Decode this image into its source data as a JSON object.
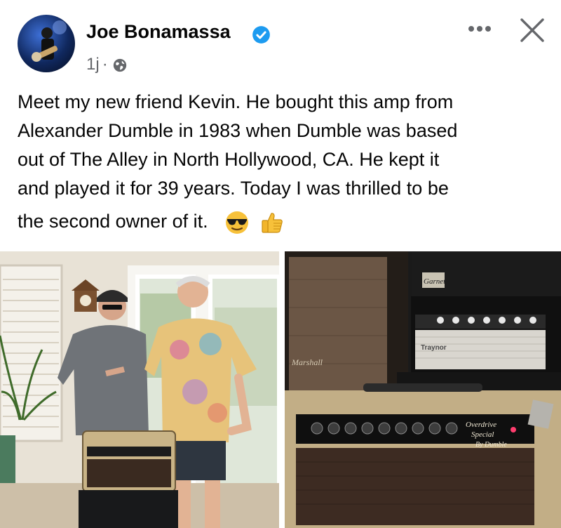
{
  "post": {
    "author": "Joe Bonamassa",
    "time": "1j",
    "separator": "·",
    "text_lines": [
      "Meet my new friend Kevin. He bought this amp from",
      "Alexander Dumble in 1983 when Dumble was based",
      "out of The Alley in North Hollywood, CA.  He kept it",
      "and played it for 39 years.  Today I was thrilled to be",
      "the second owner of it."
    ],
    "emojis": [
      "sunglasses-face-emoji",
      "thumbs-up-emoji"
    ]
  },
  "icons": {
    "verified": "verified-badge-icon",
    "audience": "globe-icon",
    "more": "more-options-icon",
    "close": "close-icon"
  },
  "photos": {
    "right": {
      "amp_badge_top": "Garnet",
      "amp_brand_mid": "Traynor",
      "cab_logo": "Marshall",
      "plate_line1": "Overdrive",
      "plate_line2": "Special",
      "plate_line3": "By Dumble"
    }
  },
  "colors": {
    "verified": "#1d9bf0",
    "secondary_text": "#65676b",
    "primary_text": "#050505"
  }
}
